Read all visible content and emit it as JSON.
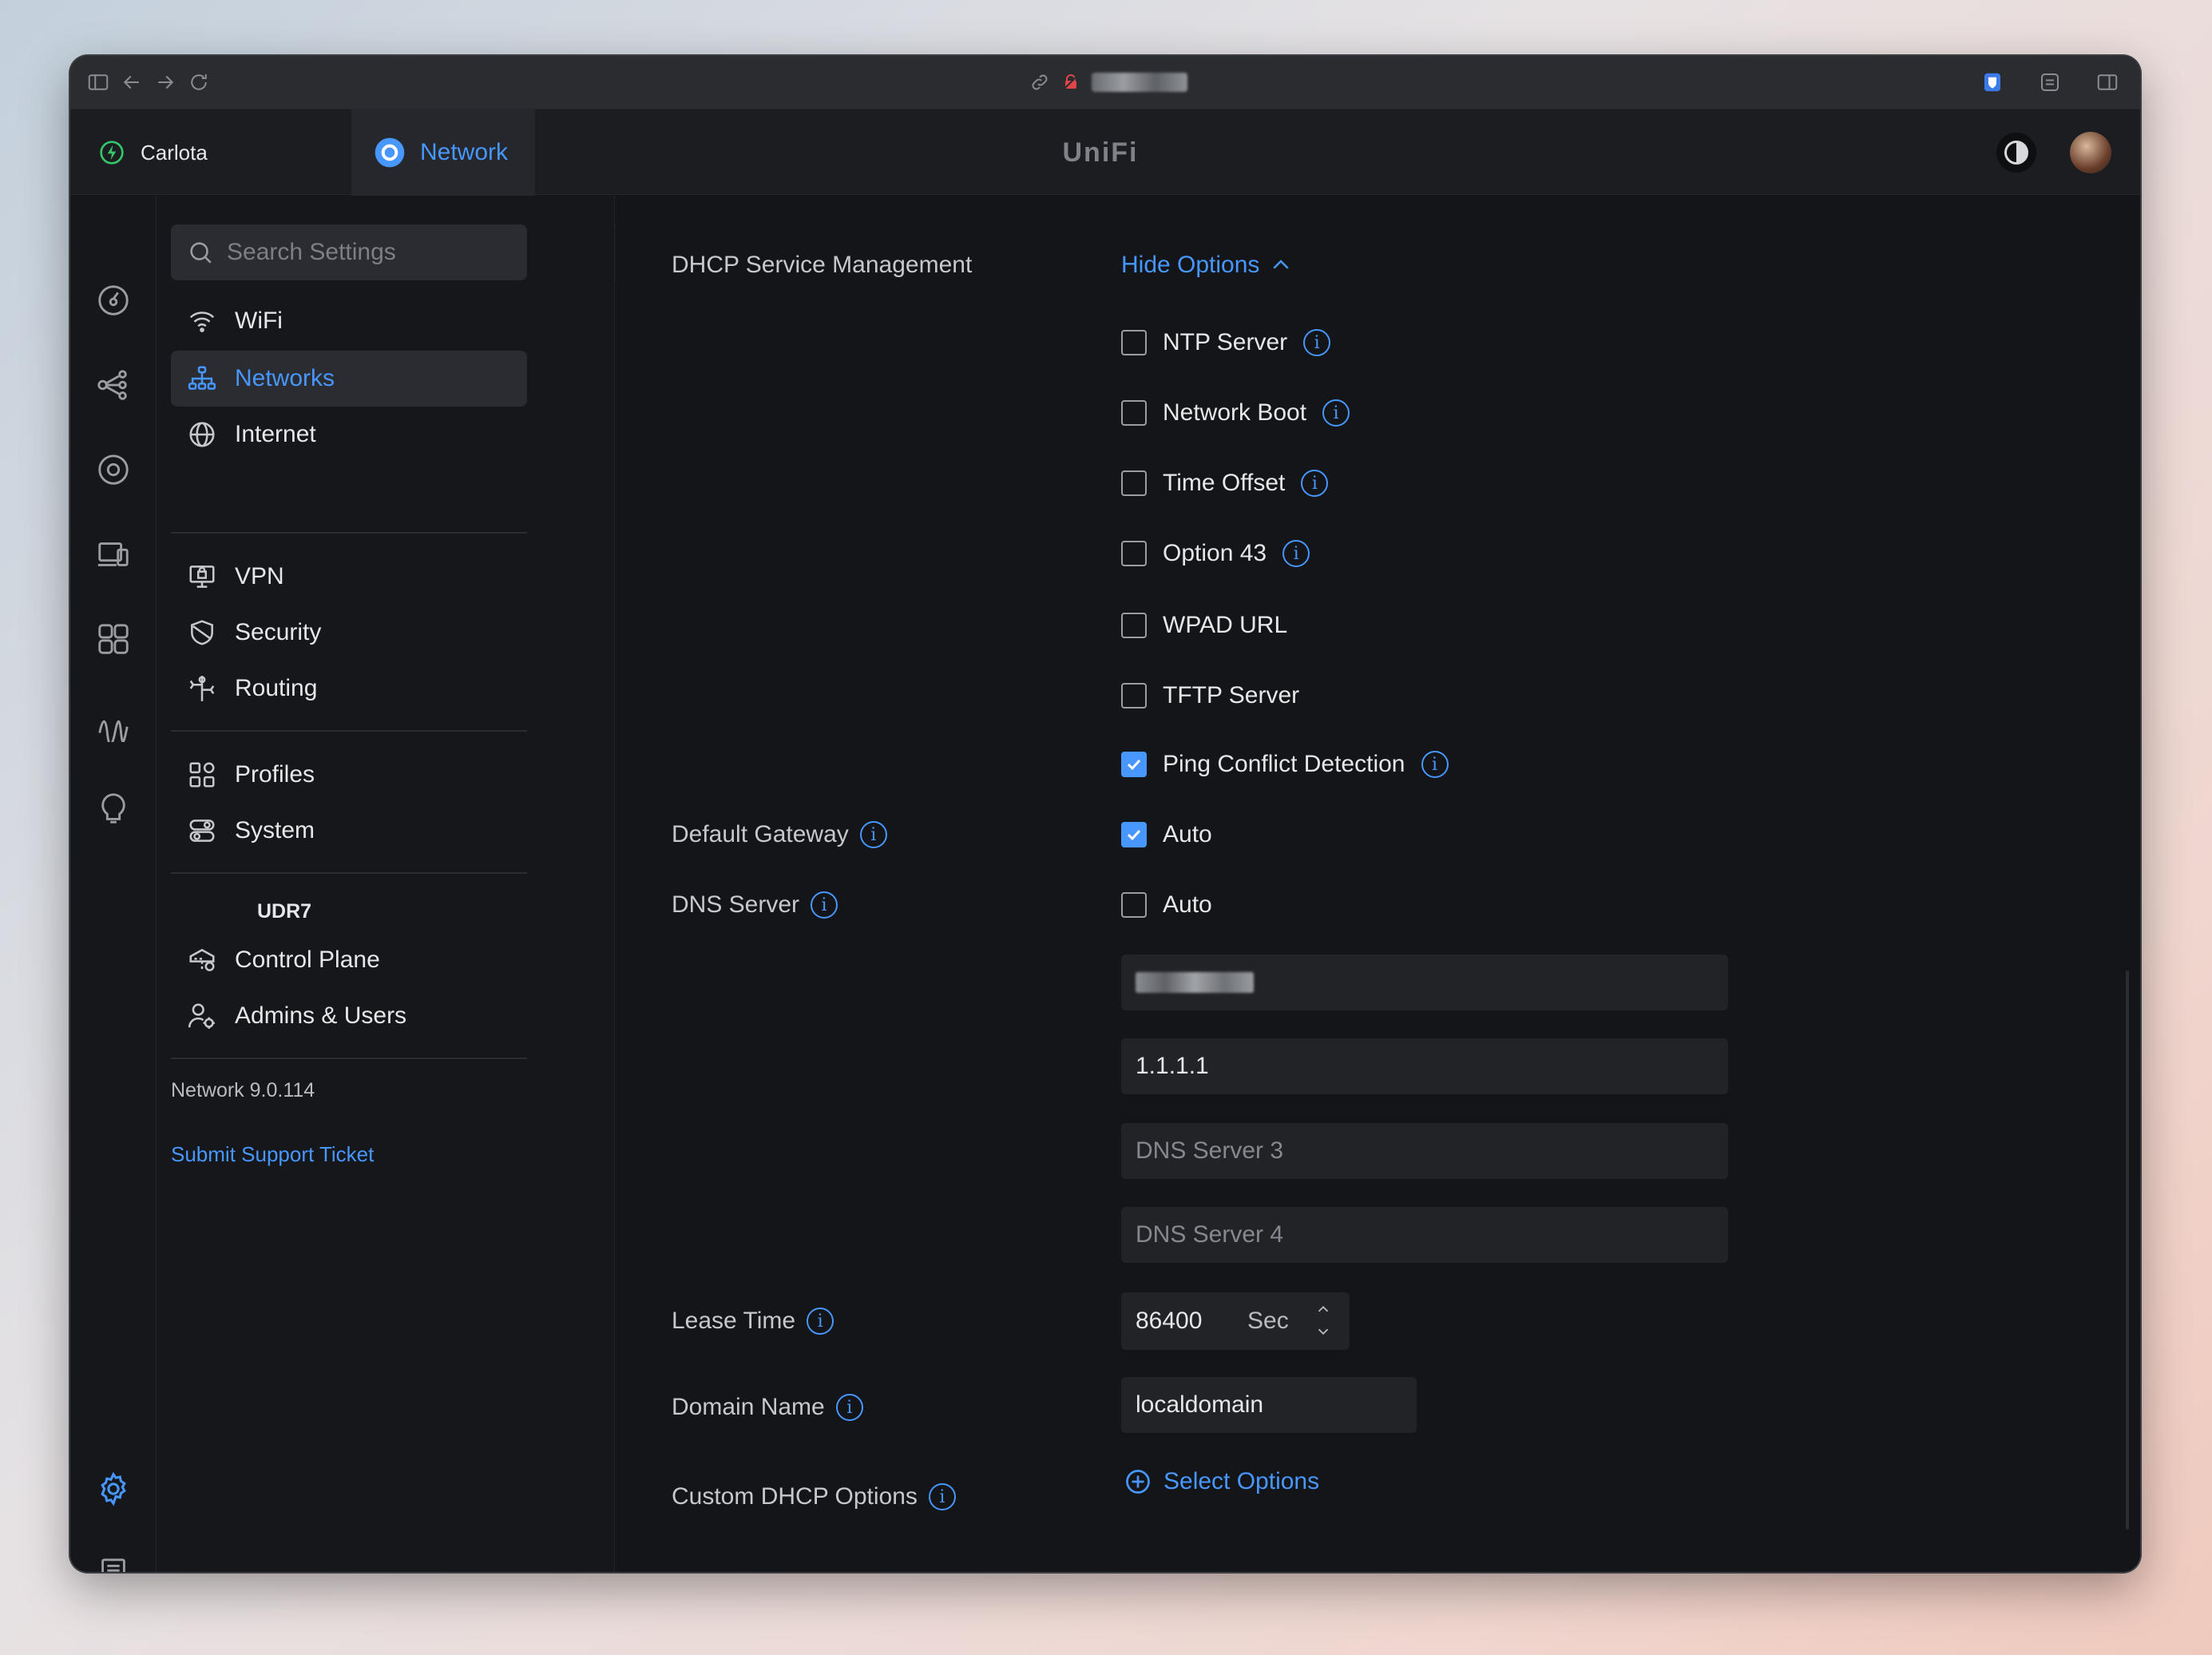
{
  "browser": {
    "url_icons": [
      "link-icon",
      "blocked-icon"
    ]
  },
  "header": {
    "site_name": "Carlota",
    "app_tab": "Network",
    "brand": "UniFi"
  },
  "sidebar": {
    "search_placeholder": "Search Settings",
    "items": [
      {
        "label": "WiFi"
      },
      {
        "label": "Networks"
      },
      {
        "label": "Internet"
      },
      {
        "label": "VPN"
      },
      {
        "label": "Security"
      },
      {
        "label": "Routing"
      },
      {
        "label": "Profiles"
      },
      {
        "label": "System"
      }
    ],
    "device_section": "UDR7",
    "device_items": [
      {
        "label": "Control Plane"
      },
      {
        "label": "Admins & Users"
      }
    ],
    "version": "Network 9.0.114",
    "support_link": "Submit Support Ticket"
  },
  "main": {
    "dhcp_service_label": "DHCP Service Management",
    "hide_options": "Hide Options",
    "options": [
      {
        "label": "NTP Server",
        "checked": false,
        "info": true
      },
      {
        "label": "Network Boot",
        "checked": false,
        "info": true
      },
      {
        "label": "Time Offset",
        "checked": false,
        "info": true
      },
      {
        "label": "Option 43",
        "checked": false,
        "info": true
      },
      {
        "label": "WPAD URL",
        "checked": false,
        "info": false
      },
      {
        "label": "TFTP Server",
        "checked": false,
        "info": false
      },
      {
        "label": "Ping Conflict Detection",
        "checked": true,
        "info": true
      }
    ],
    "default_gateway_label": "Default Gateway",
    "default_gateway_auto": "Auto",
    "dns_server_label": "DNS Server",
    "dns_server_auto": "Auto",
    "dns_server_2": "1.1.1.1",
    "dns_server_3_placeholder": "DNS Server 3",
    "dns_server_4_placeholder": "DNS Server 4",
    "lease_time_label": "Lease Time",
    "lease_time_value": "86400",
    "lease_time_unit": "Sec",
    "domain_name_label": "Domain Name",
    "domain_name_value": "localdomain",
    "custom_dhcp_label": "Custom DHCP Options",
    "select_options": "Select Options"
  },
  "colors": {
    "accent": "#4797ff",
    "background": "#131518",
    "sidebar": "#15171a",
    "field": "#212327"
  }
}
